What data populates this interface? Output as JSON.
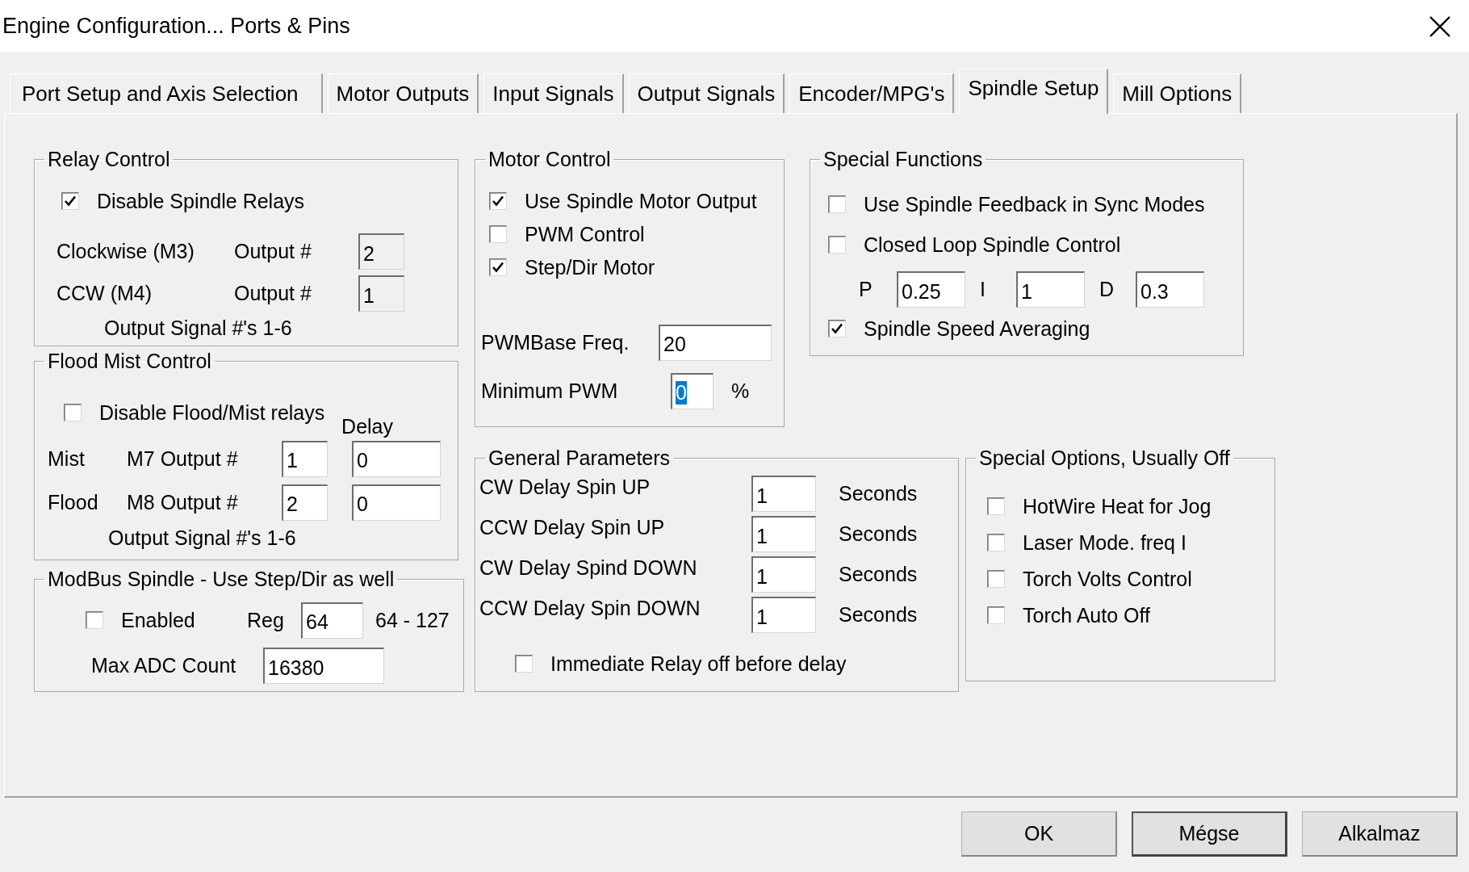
{
  "window": {
    "title": "Engine Configuration... Ports & Pins"
  },
  "tabs": [
    {
      "label": "Port Setup and Axis Selection",
      "selected": false
    },
    {
      "label": "Motor Outputs",
      "selected": false
    },
    {
      "label": "Input Signals",
      "selected": false
    },
    {
      "label": "Output Signals",
      "selected": false
    },
    {
      "label": "Encoder/MPG's",
      "selected": false
    },
    {
      "label": "Spindle Setup",
      "selected": true
    },
    {
      "label": "Mill Options",
      "selected": false
    }
  ],
  "relay_control": {
    "title": "Relay Control",
    "disable_relays": {
      "label": "Disable Spindle Relays",
      "checked": true
    },
    "rows": [
      {
        "label": "Clockwise (M3)",
        "output_label": "Output #",
        "value": "2",
        "disabled": true
      },
      {
        "label": "CCW (M4)",
        "output_label": "Output #",
        "value": "1",
        "disabled": true
      }
    ],
    "note": "Output Signal #'s 1-6"
  },
  "flood_mist_control": {
    "title": "Flood Mist Control",
    "disable_relays": {
      "label": "Disable Flood/Mist relays",
      "checked": false
    },
    "delay_label": "Delay",
    "rows": [
      {
        "name": "Mist",
        "output_label": "M7 Output #",
        "output": "1",
        "delay": "0"
      },
      {
        "name": "Flood",
        "output_label": "M8 Output #",
        "output": "2",
        "delay": "0"
      }
    ],
    "note": "Output Signal #'s 1-6"
  },
  "modbus_spindle": {
    "title": "ModBus Spindle - Use Step/Dir as well",
    "enabled": {
      "label": "Enabled",
      "checked": false
    },
    "reg_label": "Reg",
    "reg": "64",
    "range": "64 - 127",
    "max_adc_label": "Max ADC Count",
    "max_adc": "16380"
  },
  "motor_control": {
    "title": "Motor Control",
    "options": [
      {
        "label": "Use Spindle Motor Output",
        "checked": true
      },
      {
        "label": "PWM Control",
        "checked": false
      },
      {
        "label": "Step/Dir Motor",
        "checked": true
      }
    ],
    "pwm_base": {
      "label": "PWMBase Freq.",
      "value": "20"
    },
    "min_pwm": {
      "label": "Minimum PWM",
      "value": "0",
      "highlighted": true,
      "unit": "%"
    }
  },
  "special_functions": {
    "title": "Special Functions",
    "options": [
      {
        "label": "Use Spindle Feedback in Sync Modes",
        "checked": false
      },
      {
        "label": "Closed Loop Spindle Control",
        "checked": false
      }
    ],
    "pid": [
      {
        "label": "P",
        "value": "0.25"
      },
      {
        "label": "I",
        "value": "1"
      },
      {
        "label": "D",
        "value": "0.3"
      }
    ],
    "averaging": {
      "label": "Spindle Speed Averaging",
      "checked": true
    }
  },
  "general_parameters": {
    "title": "General Parameters",
    "rows": [
      {
        "label": "CW Delay Spin UP",
        "value": "1",
        "unit": "Seconds"
      },
      {
        "label": "CCW Delay Spin UP",
        "value": "1",
        "unit": "Seconds"
      },
      {
        "label": "CW Delay Spind DOWN",
        "value": "1",
        "unit": "Seconds"
      },
      {
        "label": "CCW Delay Spin DOWN",
        "value": "1",
        "unit": "Seconds"
      }
    ],
    "immediate_relay_off": {
      "label": "Immediate Relay off before delay",
      "checked": false
    }
  },
  "special_options": {
    "title": "Special Options, Usually Off",
    "options": [
      {
        "label": "HotWire Heat for Jog",
        "checked": false
      },
      {
        "label": "Laser Mode. freq I",
        "checked": false
      },
      {
        "label": "Torch Volts Control",
        "checked": false
      },
      {
        "label": "Torch Auto Off",
        "checked": false
      }
    ]
  },
  "buttons": [
    {
      "label": "OK",
      "default": false
    },
    {
      "label": "Mégse",
      "default": true
    },
    {
      "label": "Alkalmaz",
      "default": false
    }
  ]
}
